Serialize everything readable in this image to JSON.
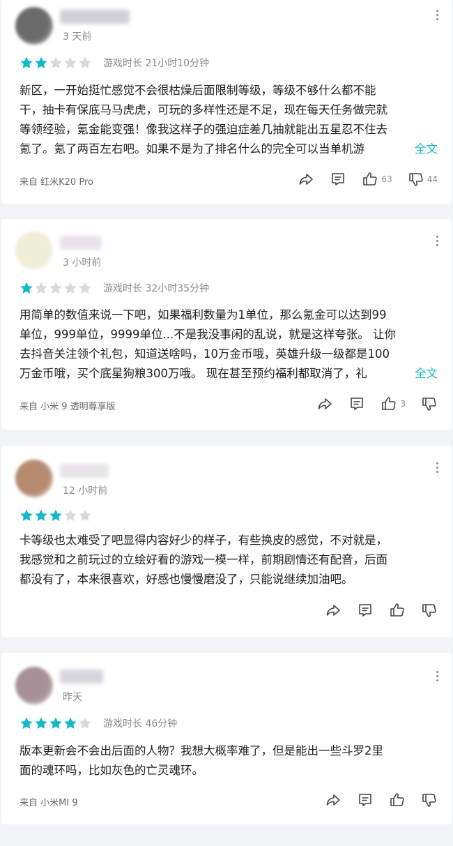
{
  "reviews": [
    {
      "avatar_color": "#6b6b6b",
      "time": "3 天前",
      "stars": 2,
      "playtime": "游戏时长 21小时10分钟",
      "lines": [
        "新区，一开始挺忙感觉不会很枯燥后面限制等级，等级不够什么都不能",
        "干，抽卡有保底马马虎虎，可玩的多样性还是不足，现在每天任务做完就",
        "等领经验，氪金能变强！像我这样子的强迫症差几抽就能出五星忍不住去",
        "氪了。氪了两百左右吧。如果不是为了排名什么的完全可以当单机游"
      ],
      "more_label": "全文",
      "device": "来自 红米K20 Pro",
      "likes": "63",
      "dislikes": "44"
    },
    {
      "avatar_color": "#efeed6",
      "time": "3 小时前",
      "stars": 1,
      "playtime": "游戏时长 32小时35分钟",
      "lines": [
        "用简单的数值来说一下吧，如果福利数量为1单位，那么氪金可以达到99",
        "单位，999单位，9999单位...不是我没事闲的乱说，就是这样夸张。 让你",
        "去抖音关注领个礼包，知道送啥吗，10万金币哦，英雄升级一级都是100",
        "万金币哦，买个底星狗粮300万哦。 现在甚至预约福利都取消了，礼"
      ],
      "more_label": "全文",
      "device": "来自 小米 9 透明尊享版",
      "likes": "3",
      "dislikes": ""
    },
    {
      "avatar_color": "#b58a6e",
      "time": "12 小时前",
      "stars": 3,
      "playtime": "",
      "lines": [
        "卡等级也太难受了吧显得内容好少的样子，有些换皮的感觉，不对就是，",
        "我感觉和之前玩过的立绘好看的游戏一模一样，前期剧情还有配音，后面",
        "都没有了，本来很喜欢，好感也慢慢磨没了，只能说继续加油吧。"
      ],
      "more_label": "",
      "device": "",
      "likes": "",
      "dislikes": ""
    },
    {
      "avatar_color": "#a89098",
      "time": "昨天",
      "stars": 4,
      "playtime": "游戏时长 46分钟",
      "lines": [
        "版本更新会不会出后面的人物？我想大概率难了，但是能出一些斗罗2里",
        "面的魂环吗，比如灰色的亡灵魂环。"
      ],
      "more_label": "",
      "device": "来自 小米MI 9",
      "likes": "",
      "dislikes": ""
    }
  ],
  "colors": {
    "star_on": "#14b9c8",
    "star_off": "#d9d9d9",
    "accent": "#14b9c8"
  },
  "icons": [
    "share-icon",
    "comment-icon",
    "thumb-up-icon",
    "thumb-down-icon",
    "more-vert-icon",
    "star-icon"
  ]
}
